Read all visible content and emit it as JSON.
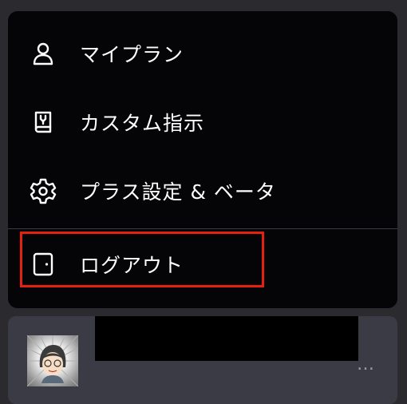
{
  "menu": {
    "items": [
      {
        "label": "マイプラン",
        "icon": "user-icon"
      },
      {
        "label": "カスタム指示",
        "icon": "book-icon"
      },
      {
        "label": "プラス設定 & ベータ",
        "icon": "gear-icon"
      },
      {
        "label": "ログアウト",
        "icon": "logout-door-icon"
      }
    ]
  },
  "highlight_color": "#e32012",
  "profile": {
    "more_label": "…"
  }
}
